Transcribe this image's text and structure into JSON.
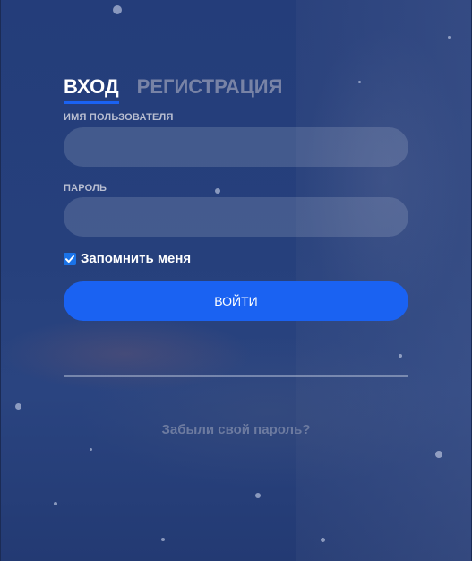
{
  "tabs": {
    "login": "ВХОД",
    "register": "РЕГИСТРАЦИЯ"
  },
  "form": {
    "username_label": "ИМЯ ПОЛЬЗОВАТЕЛЯ",
    "username_value": "",
    "password_label": "ПАРОЛЬ",
    "password_value": "",
    "remember_label": "Запомнить меня",
    "remember_checked": true,
    "submit_label": "ВОЙТИ"
  },
  "footer": {
    "forgot_password": "Забыли свой пароль?"
  },
  "colors": {
    "accent": "#1a62f2",
    "background": "#26407c",
    "inactive_tab": "#7883a6",
    "link": "#6d7ba0"
  }
}
